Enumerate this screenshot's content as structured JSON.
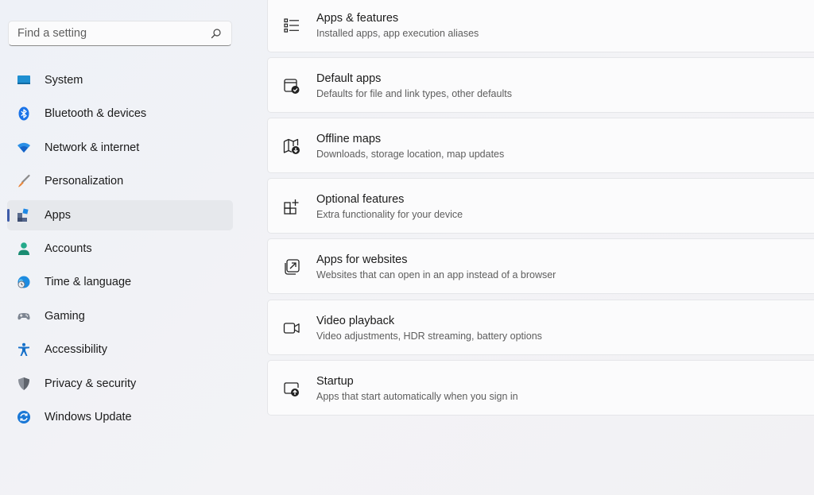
{
  "search": {
    "placeholder": "Find a setting",
    "icon": "search-icon"
  },
  "sidebar": {
    "items": [
      {
        "label": "System",
        "icon": "system-icon",
        "active": false
      },
      {
        "label": "Bluetooth & devices",
        "icon": "bluetooth-icon",
        "active": false
      },
      {
        "label": "Network & internet",
        "icon": "wifi-icon",
        "active": false
      },
      {
        "label": "Personalization",
        "icon": "brush-icon",
        "active": false
      },
      {
        "label": "Apps",
        "icon": "apps-icon",
        "active": true
      },
      {
        "label": "Accounts",
        "icon": "person-icon",
        "active": false
      },
      {
        "label": "Time & language",
        "icon": "globe-clock-icon",
        "active": false
      },
      {
        "label": "Gaming",
        "icon": "gamepad-icon",
        "active": false
      },
      {
        "label": "Accessibility",
        "icon": "accessibility-icon",
        "active": false
      },
      {
        "label": "Privacy & security",
        "icon": "shield-icon",
        "active": false
      },
      {
        "label": "Windows Update",
        "icon": "update-icon",
        "active": false
      }
    ]
  },
  "main": {
    "cards": [
      {
        "title": "Apps & features",
        "subtitle": "Installed apps, app execution aliases",
        "icon": "list-icon"
      },
      {
        "title": "Default apps",
        "subtitle": "Defaults for file and link types, other defaults",
        "icon": "default-apps-icon"
      },
      {
        "title": "Offline maps",
        "subtitle": "Downloads, storage location, map updates",
        "icon": "map-download-icon"
      },
      {
        "title": "Optional features",
        "subtitle": "Extra functionality for your device",
        "icon": "add-grid-icon"
      },
      {
        "title": "Apps for websites",
        "subtitle": "Websites that can open in an app instead of a browser",
        "icon": "open-external-icon"
      },
      {
        "title": "Video playback",
        "subtitle": "Video adjustments, HDR streaming, battery options",
        "icon": "video-icon"
      },
      {
        "title": "Startup",
        "subtitle": "Apps that start automatically when you sign in",
        "icon": "startup-icon"
      }
    ]
  },
  "colors": {
    "accent": "#3d5ba8",
    "card_background": "#fbfbfc",
    "window_background": "#eef1f6",
    "active_item_background": "#e6e8ec"
  }
}
